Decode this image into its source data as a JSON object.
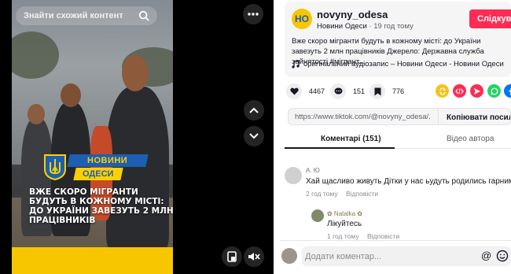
{
  "video": {
    "search_placeholder": "Знайти схожий контент",
    "brand_top": "НОВИНИ",
    "brand_bottom": "ОДЕСИ",
    "headline": "ВЖЕ СКОРО МІГРАНТИ БУДУТЬ В КОЖНОМУ МІСТІ: ДО УКРАЇНИ ЗАВЕЗУТЬ 2 МЛН ПРАЦІВНИКІВ"
  },
  "author": {
    "avatar_text": "НО",
    "username": "novyny_odesa",
    "display_name": "Новини Одеси",
    "time": "19 год тому",
    "follow_label": "Слідкувати"
  },
  "post": {
    "description": "Вже скоро мігранти будуть в кожному місті: до України завезуть 2 млн працівників Джерело: Державна служба зайнятості #мігрант...",
    "music": "оригінальний аудіозапис – Новини Одеси - Новини Одеси"
  },
  "actions": {
    "likes": "4467",
    "comments": "151",
    "saves": "776"
  },
  "share_colors": {
    "repost": "#f6c21a",
    "embed": "#fe2c55",
    "send": "#fe2c55",
    "whatsapp": "#25d366",
    "facebook": "#0075fa"
  },
  "link": {
    "url": "https://www.tiktok.com/@novyny_odesa/...",
    "copy_label": "Копіювати посилання"
  },
  "tabs": {
    "comments": "Коментарі (151)",
    "author_videos": "Відео автора"
  },
  "comments": [
    {
      "name": "А. Ю",
      "text": "Хай щасливо живуть Дітки у нас ьудуть родились гарними",
      "time": "2 год тому",
      "reply": "Відповісти"
    }
  ],
  "replies": [
    {
      "name": "✿ Natalka ✿",
      "text": "Лікуйтесь",
      "time": "1 год тому",
      "reply": "Відповісти"
    }
  ],
  "composer": {
    "placeholder": "Додати коментар..."
  }
}
